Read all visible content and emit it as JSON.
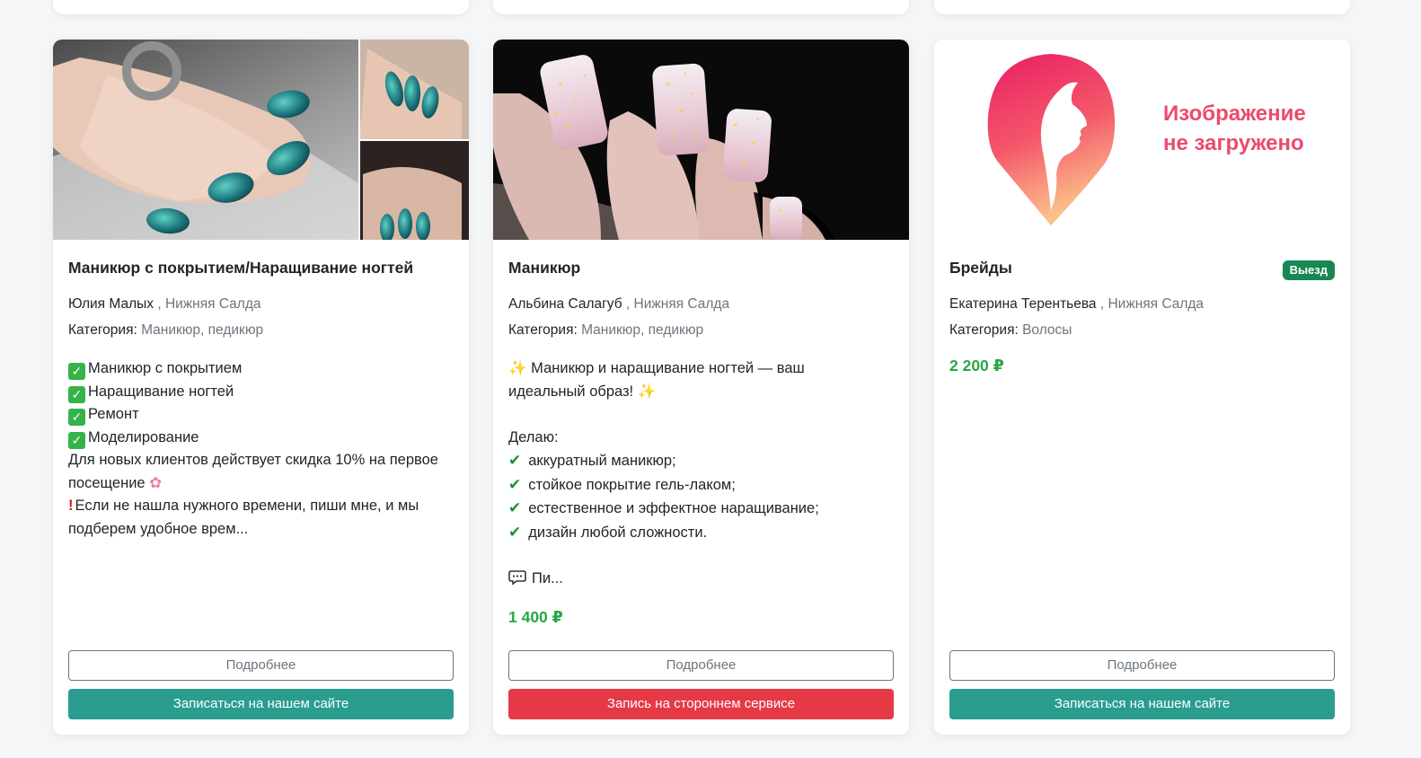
{
  "colors": {
    "accent_teal": "#2a9d8f",
    "accent_red": "#e63946",
    "price_green": "#28a745",
    "badge_green": "#198754"
  },
  "cards": [
    {
      "title": "Маникюр с покрытием/Наращивание ногтей",
      "master": "Юлия Малых",
      "city": ", Нижняя Салда",
      "category_label": "Категория:",
      "category": "Маникюр, педикюр",
      "desc": [
        "Маникюр с покрытием",
        "Наращивание ногтей",
        "Ремонт",
        "Моделирование",
        "Для новых клиентов действует скидка 10% на первое",
        "посещение",
        "Если не нашла нужного времени, пиши мне, и мы",
        "подберем удобное врем..."
      ],
      "more_label": "Подробнее",
      "book_label": "Записаться на нашем сайте",
      "image_icon": "green-glitter-nails-photo"
    },
    {
      "title": "Маникюр",
      "master": "Альбина Салагуб",
      "city": ", Нижняя Салда",
      "category_label": "Категория:",
      "category": "Маникюр, педикюр",
      "desc": [
        "Маникюр и наращивание ногтей — ваш",
        "идеальный образ!",
        "",
        "Делаю:",
        "аккуратный маникюр;",
        "стойкое покрытие гель-лаком;",
        "естественное и эффектное наращивание;",
        "дизайн любой сложности.",
        "",
        "Пи..."
      ],
      "price": "1 400 ₽",
      "more_label": "Подробнее",
      "book_label": "Запись на стороннем сервисе",
      "image_icon": "sparkle-nails-photo"
    },
    {
      "title": "Брейды",
      "badge": "Выезд",
      "master": "Екатерина Терентьева",
      "city": ", Нижняя Салда",
      "category_label": "Категория:",
      "category": "Волосы",
      "price": "2 200 ₽",
      "placeholder_line1": "Изображение",
      "placeholder_line2": "не загружено",
      "more_label": "Подробнее",
      "book_label": "Записаться на нашем сайте",
      "image_icon": "woman-silhouette-logo-icon"
    }
  ]
}
